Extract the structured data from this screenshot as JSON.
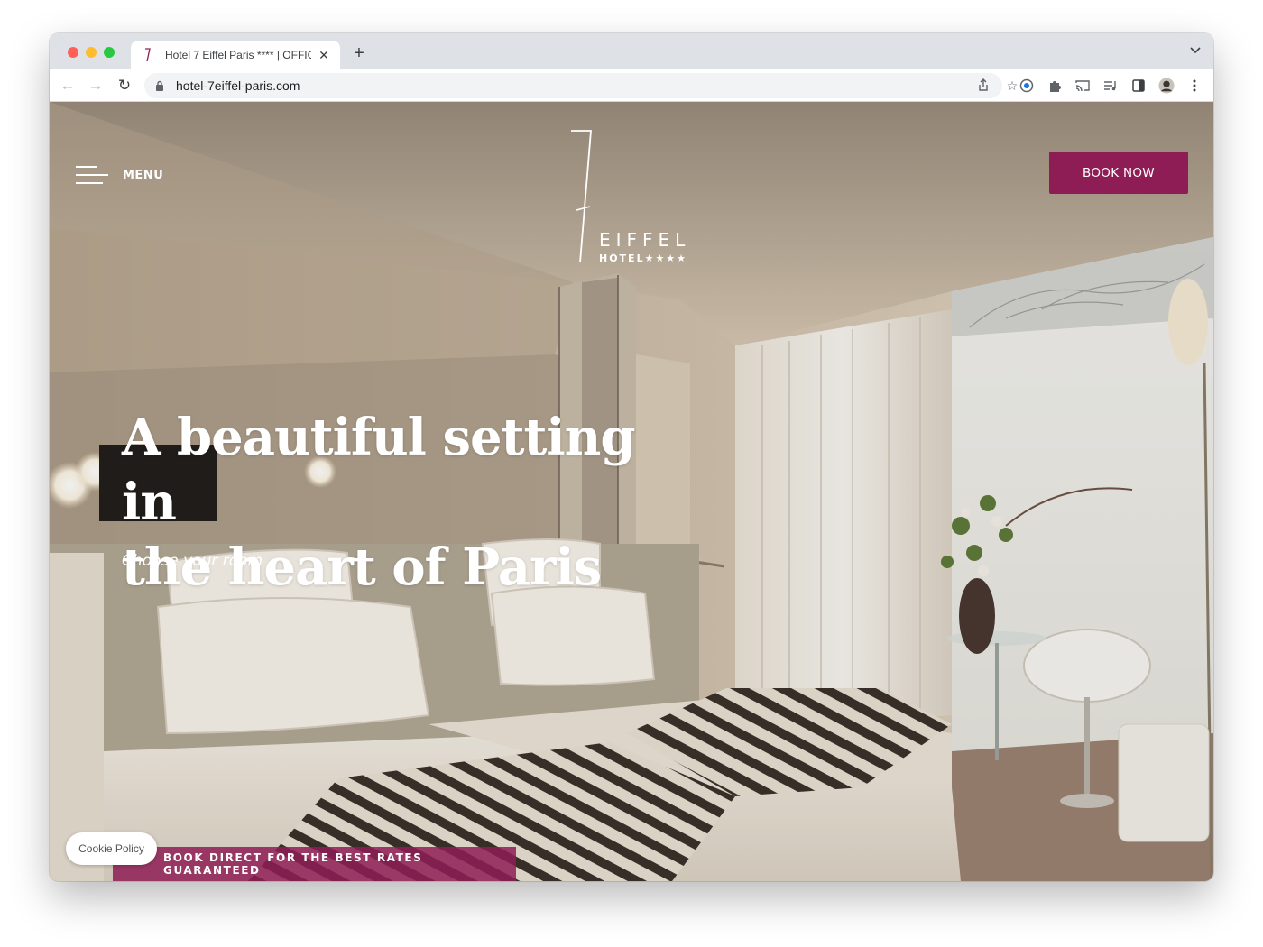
{
  "browser": {
    "tab_title": "Hotel 7 Eiffel Paris **** | OFFIC",
    "tab_close": "✕",
    "new_tab": "+",
    "url": "hotel-7eiffel-paris.com"
  },
  "header": {
    "menu_label": "MENU",
    "logo_word": "EIFFEL",
    "logo_sub": "HÔTEL★★★★",
    "book_label": "BOOK NOW"
  },
  "hero": {
    "headline_line1": "A beautiful setting in",
    "headline_line2": "the heart of Paris",
    "subline": "Choose your room"
  },
  "footer": {
    "promo": "BOOK DIRECT FOR THE BEST RATES GUARANTEED",
    "cookie": "Cookie Policy"
  },
  "colors": {
    "brand": "#8e1d55",
    "tab_strip": "#dee1e6"
  },
  "icons": [
    "back-arrow-icon",
    "forward-arrow-icon",
    "reload-icon",
    "lock-icon",
    "share-icon",
    "star-icon",
    "extension-icon",
    "cast-icon",
    "media-icon",
    "sidepanel-icon",
    "avatar",
    "kebab-menu-icon",
    "hamburger-icon"
  ]
}
